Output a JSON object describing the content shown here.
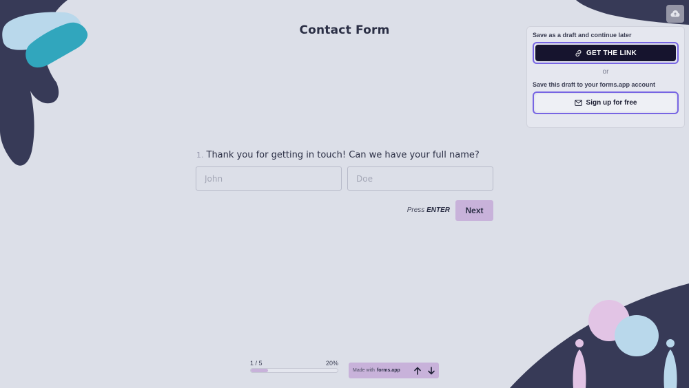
{
  "form": {
    "title": "Contact Form"
  },
  "save_panel": {
    "draft_label": "Save as a draft and continue later",
    "link_button_label": "GET THE LINK",
    "or_label": "or",
    "account_label": "Save this draft to your forms.app account",
    "signup_button_label": "Sign up for free"
  },
  "question": {
    "number": "1.",
    "text": "Thank you for getting in touch! Can we have your full name?",
    "first_name_placeholder": "John",
    "last_name_placeholder": "Doe"
  },
  "navigation": {
    "press_text": "Press",
    "press_key": "ENTER",
    "next_label": "Next"
  },
  "progress": {
    "step_label": "1 / 5",
    "percent_label": "20%",
    "fraction": 0.2
  },
  "branding": {
    "made_with_text": "Made with",
    "brand_name": "forms.app"
  },
  "colors": {
    "background": "#dcdfe8",
    "accent_purple": "#c8b2da",
    "dark_button": "#16142e",
    "focus_outline": "#7765e3",
    "decor_navy": "#373a57",
    "decor_teal": "#31a6bd",
    "decor_light_blue": "#b9d8eb",
    "decor_pink": "#e2c4e5"
  },
  "icons": {
    "save": "cloud-upload-icon",
    "link": "link-icon",
    "mail": "mail-icon",
    "up": "arrow-up-icon",
    "down": "arrow-down-icon"
  }
}
